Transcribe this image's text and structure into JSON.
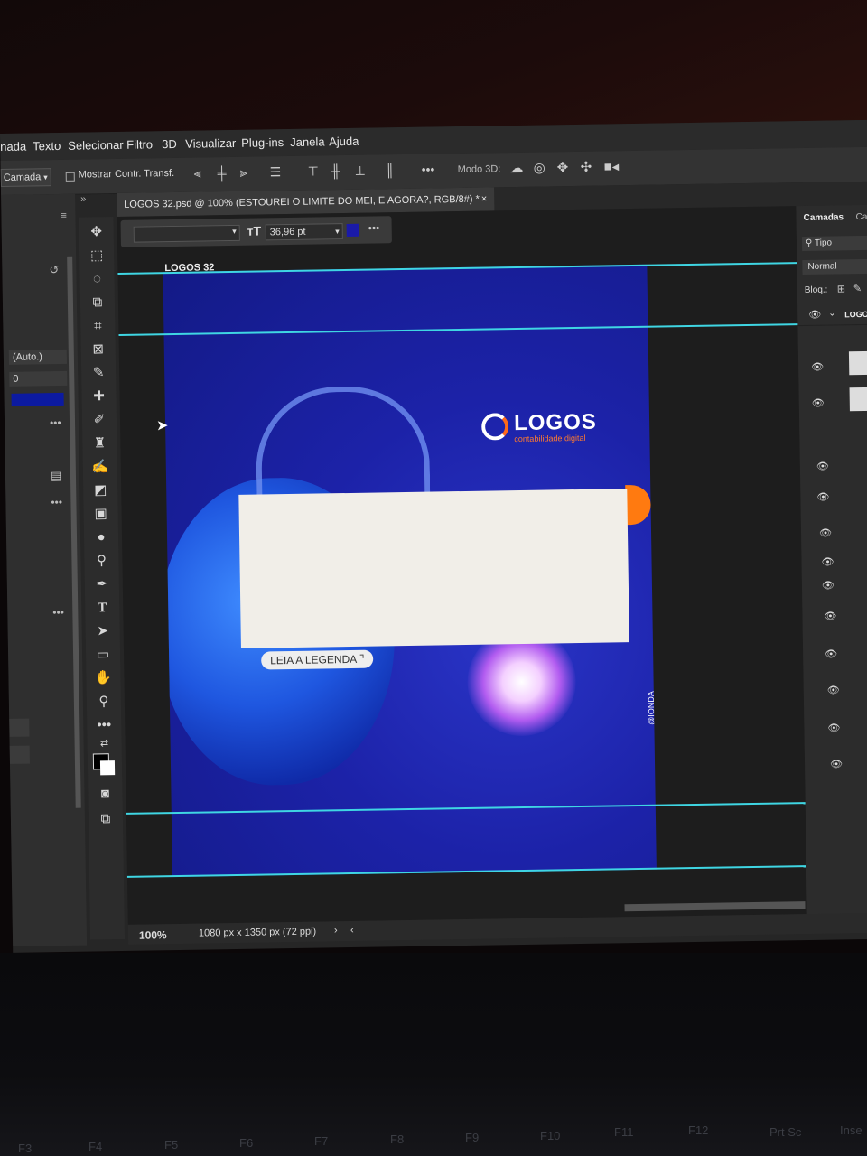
{
  "menu": [
    "nada",
    "Texto",
    "Selecionar",
    "Filtro",
    "3D",
    "Visualizar",
    "Plug-ins",
    "Janela",
    "Ajuda"
  ],
  "options": {
    "layer_select": "Camada",
    "transform_toggle_label": "Mostrar Contr. Transf.",
    "mode3d_label": "Modo 3D:"
  },
  "document_tab": {
    "title": "LOGOS 32.psd @ 100% (ESTOUREI O LIMITE DO MEI, E AGORA?, RGB/8#) *",
    "close": "×"
  },
  "text_options": {
    "font_size": "36,96 pt",
    "color": "#1a1aa8",
    "more": "•••"
  },
  "left_panel": {
    "leading": "(Auto.)",
    "tracking": "0",
    "color_swatch": "#0c1aa0"
  },
  "artboard": {
    "label": "LOGOS 32",
    "logo_word": "LOGOS",
    "logo_sub": "contabilidade digital",
    "button": "LEIA A LEGENDA",
    "credit": "@IONDA"
  },
  "layers_panel": {
    "tab1": "Camadas",
    "tab2": "Ca",
    "search": "Tipo",
    "blend": "Normal",
    "lock_label": "Bloq.:",
    "top_layer": "LOGO"
  },
  "status": {
    "zoom": "100%",
    "doc_info": "1080 px x 1350 px (72 ppi)"
  },
  "keyboard": [
    "F3",
    "F4",
    "F5",
    "F6",
    "F7",
    "F8",
    "F9",
    "F10",
    "F11",
    "F12",
    "Prt Sc",
    "Inse"
  ],
  "colors": {
    "guide": "#3fd6e3",
    "accent_orange": "#ff7a10"
  }
}
